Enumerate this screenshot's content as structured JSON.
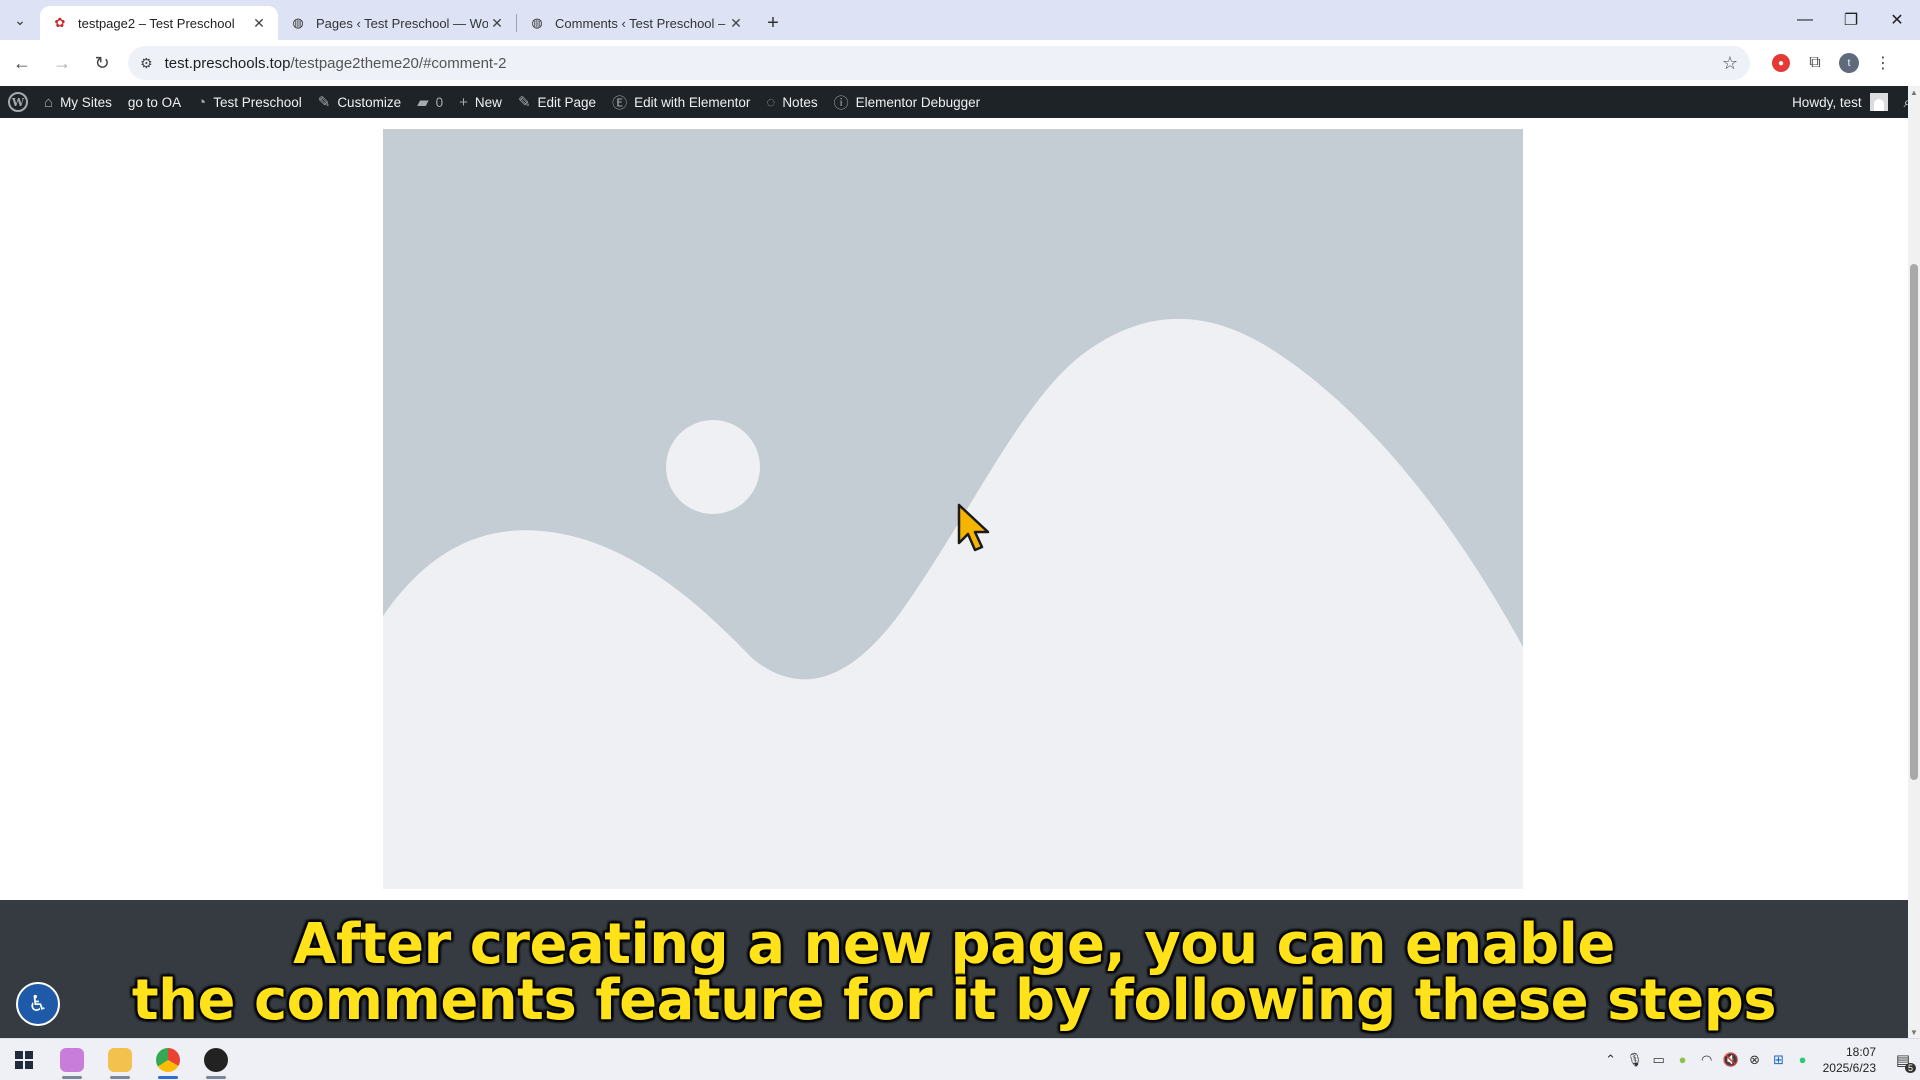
{
  "browser": {
    "tabs": [
      {
        "title": "testpage2 – Test Preschool",
        "active": true
      },
      {
        "title": "Pages ‹ Test Preschool — Wo",
        "active": false
      },
      {
        "title": "Comments ‹ Test Preschool –",
        "active": false
      }
    ],
    "address": {
      "host": "test.preschools.top",
      "path": "/testpage2theme20/#comment-2"
    }
  },
  "adminbar": {
    "items": [
      {
        "label": "My Sites",
        "icon": "my-sites-icon"
      },
      {
        "label": "go to OA",
        "icon": ""
      },
      {
        "label": "Test Preschool",
        "icon": "dashboard-icon"
      },
      {
        "label": "Customize",
        "icon": "brush-icon"
      },
      {
        "label": "0",
        "icon": "comment-icon"
      },
      {
        "label": "New",
        "icon": "plus-icon"
      },
      {
        "label": "Edit Page",
        "icon": "pencil-icon"
      },
      {
        "label": "Edit with Elementor",
        "icon": "elementor-icon"
      },
      {
        "label": "Notes",
        "icon": "notes-icon"
      },
      {
        "label": "Elementor Debugger",
        "icon": "info-icon"
      }
    ],
    "howdy": "Howdy, test"
  },
  "caption": {
    "line1": "After creating a new page, you can enable",
    "line2": "the comments feature for it by following these steps"
  },
  "colors": {
    "caption_text": "#ffe21a",
    "placeholder_bg": "#c4ccd4",
    "placeholder_fg": "#eff0f3",
    "adminbar_bg": "#1d2327"
  },
  "taskbar": {
    "time": "18:07",
    "date": "2025/6/23",
    "notifications": "5"
  }
}
